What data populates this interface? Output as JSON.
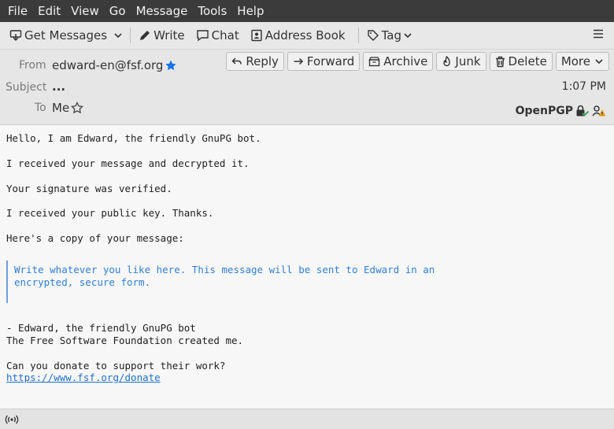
{
  "menu": {
    "items": [
      {
        "label": "File"
      },
      {
        "label": "Edit"
      },
      {
        "label": "View"
      },
      {
        "label": "Go"
      },
      {
        "label": "Message"
      },
      {
        "label": "Tools"
      },
      {
        "label": "Help"
      }
    ]
  },
  "toolbar": {
    "get_messages": "Get Messages",
    "write": "Write",
    "chat": "Chat",
    "address_book": "Address Book",
    "tag": "Tag"
  },
  "header": {
    "from_label": "From",
    "from_value": "edward-en@fsf.org",
    "subject_label": "Subject",
    "subject_value": "...",
    "to_label": "To",
    "to_value": "Me",
    "time": "1:07 PM",
    "openpgp": "OpenPGP",
    "actions": {
      "reply": "Reply",
      "forward": "Forward",
      "archive": "Archive",
      "junk": "Junk",
      "delete": "Delete",
      "more": "More"
    }
  },
  "message": {
    "l1": "Hello, I am Edward, the friendly GnuPG bot.",
    "l2": "I received your message and decrypted it.",
    "l3": "Your signature was verified.",
    "l4": "I received your public key. Thanks.",
    "l5": "Here's a copy of your message:",
    "quote1": "Write whatever you like here. This message will be sent to Edward in an",
    "quote2": "encrypted, secure form.",
    "l6": "- Edward, the friendly GnuPG bot",
    "l7": "The Free Software Foundation created me.",
    "l8": "Can you donate to support their work?",
    "link": "https://www.fsf.org/donate"
  },
  "colors": {
    "menubar": "#3b3b3b",
    "accent_star": "#1a73e8",
    "quote": "#2f7fd6",
    "link": "#1f6fc9",
    "pgp_ok": "#3aa655",
    "pgp_warn": "#e8a317"
  }
}
